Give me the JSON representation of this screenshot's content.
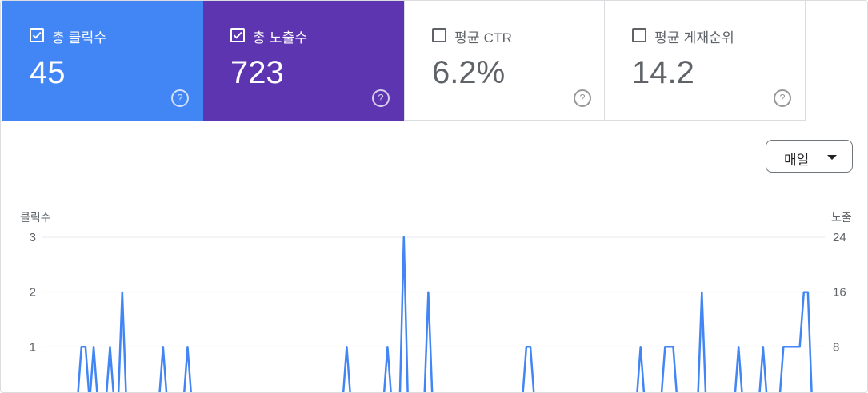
{
  "cards": [
    {
      "label": "총 클릭수",
      "value": "45",
      "checked": true,
      "color": "#4285f4"
    },
    {
      "label": "총 노출수",
      "value": "723",
      "checked": true,
      "color": "#5e35b1"
    },
    {
      "label": "평균 CTR",
      "value": "6.2%",
      "checked": false,
      "color": "#ffffff"
    },
    {
      "label": "평균 게재순위",
      "value": "14.2",
      "checked": false,
      "color": "#ffffff"
    }
  ],
  "help_icon": "?",
  "granularity": {
    "label": "매일",
    "icon": "caret-down-icon"
  },
  "chart_data": {
    "type": "line",
    "grid": true,
    "left_axis": {
      "title": "클릭수",
      "ticks": [
        "3",
        "2",
        "1"
      ],
      "range": [
        0,
        3
      ]
    },
    "right_axis": {
      "title": "노출",
      "ticks": [
        "24",
        "16",
        "8"
      ],
      "range": [
        0,
        24
      ]
    },
    "series": [
      {
        "name": "클릭수",
        "axis": "left",
        "color": "#4285f4",
        "values": [
          0,
          0,
          0,
          0,
          0,
          0,
          0,
          0,
          1,
          1,
          0,
          1,
          0,
          0,
          0,
          1,
          0,
          0,
          2,
          0,
          0,
          0,
          0,
          0,
          0,
          0,
          0,
          0,
          1,
          0,
          0,
          0,
          0,
          0,
          1,
          0,
          0,
          0,
          0,
          0,
          0,
          0,
          0,
          0,
          0,
          0,
          0,
          0,
          0,
          0,
          0,
          0,
          0,
          0,
          0,
          0,
          0,
          0,
          0,
          0,
          0,
          0,
          0,
          0,
          0,
          0,
          0,
          0,
          0,
          0,
          0,
          0,
          0,
          1,
          0,
          0,
          0,
          0,
          0,
          0,
          0,
          0,
          0,
          1,
          0,
          0,
          0,
          3,
          0,
          0,
          0,
          0,
          0,
          2,
          0,
          0,
          0,
          0,
          0,
          0,
          0,
          0,
          0,
          0,
          0,
          0,
          0,
          0,
          0,
          0,
          0,
          0,
          0,
          0,
          0,
          0,
          0,
          1,
          1,
          0,
          0,
          0,
          0,
          0,
          0,
          0,
          0,
          0,
          0,
          0,
          0,
          0,
          0,
          0,
          0,
          0,
          0,
          0,
          0,
          0,
          0,
          0,
          0,
          0,
          0,
          1,
          0,
          0,
          0,
          0,
          0,
          1,
          1,
          1,
          0,
          0,
          0,
          0,
          0,
          0,
          2,
          0,
          0,
          0,
          0,
          0,
          0,
          0,
          0,
          1,
          0,
          0,
          0,
          0,
          0,
          1,
          0,
          0,
          0,
          0,
          1,
          1,
          1,
          1,
          1,
          2,
          2,
          0
        ]
      },
      {
        "name": "노출",
        "axis": "right",
        "color": "#5e35b1",
        "values": [
          0,
          0,
          0,
          0,
          0,
          0,
          0,
          0,
          0,
          0,
          0,
          0,
          0,
          0,
          0,
          0,
          0,
          0,
          0,
          0,
          0,
          0,
          0,
          0,
          0,
          0,
          0,
          0,
          0,
          0,
          0,
          0,
          0,
          0,
          0,
          0,
          0,
          0,
          0,
          0,
          0,
          0,
          0,
          0,
          0,
          0,
          0,
          0,
          0,
          0,
          0,
          0,
          0,
          0,
          0,
          0,
          0,
          0,
          0,
          0,
          0,
          0,
          0,
          0,
          0,
          0,
          0,
          0,
          0,
          0,
          0,
          0,
          0,
          0,
          0,
          0,
          0,
          0,
          0,
          0,
          0,
          0,
          0,
          0,
          0,
          0,
          0,
          0,
          0,
          0,
          0,
          0,
          0,
          0,
          0,
          0,
          0,
          0,
          0,
          0,
          0,
          0,
          0,
          0,
          0,
          0,
          0,
          0,
          0,
          0,
          0,
          0,
          0,
          0,
          0,
          0,
          0,
          0,
          0,
          0,
          0,
          0,
          0,
          0,
          0,
          0,
          0,
          0,
          0,
          0,
          0,
          0,
          0,
          0,
          0,
          0,
          0,
          0,
          0,
          0,
          0,
          0,
          0,
          0,
          0,
          0,
          0,
          0,
          0,
          0,
          0,
          0,
          0,
          0,
          0,
          0,
          0,
          0,
          0,
          0,
          0,
          0,
          0,
          0,
          0,
          0,
          0,
          0,
          0,
          0,
          0,
          0,
          0,
          0,
          0,
          0,
          0,
          0,
          0,
          0,
          0,
          0,
          0,
          0,
          0,
          0,
          0,
          0,
          0,
          0,
          0,
          0
        ]
      }
    ]
  }
}
